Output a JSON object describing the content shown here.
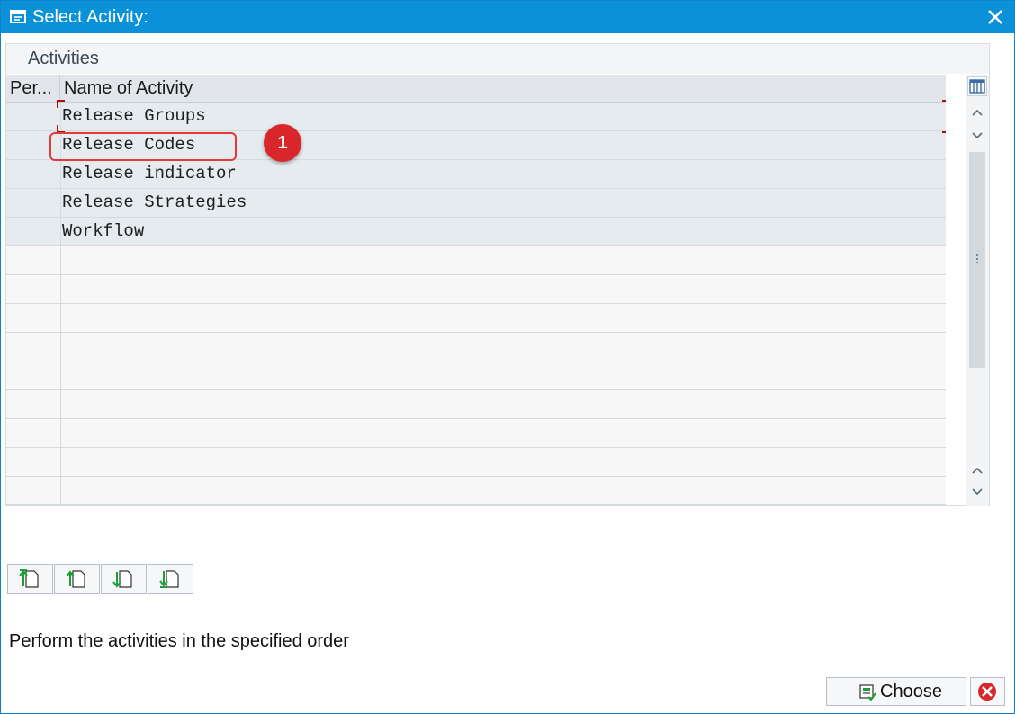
{
  "window": {
    "title": "Select Activity:"
  },
  "panel": {
    "title": "Activities"
  },
  "table": {
    "columns": [
      "Per...",
      "Name of Activity"
    ],
    "rows": [
      "Release Groups",
      "Release Codes",
      "Release indicator",
      "Release Strategies",
      "Workflow"
    ]
  },
  "annotation": {
    "badge": "1"
  },
  "info_text": "Perform the activities in the specified order",
  "buttons": {
    "choose": "Choose"
  },
  "colors": {
    "titlebar": "#0a91d8",
    "accent_red": "#d9262a"
  }
}
